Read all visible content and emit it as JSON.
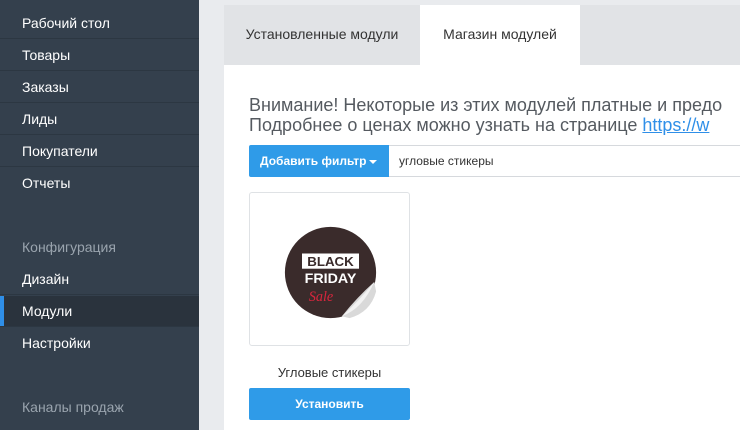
{
  "sidebar": {
    "items": [
      {
        "label": "Рабочий стол"
      },
      {
        "label": "Товары"
      },
      {
        "label": "Заказы"
      },
      {
        "label": "Лиды"
      },
      {
        "label": "Покупатели"
      },
      {
        "label": "Отчеты"
      }
    ],
    "config_section": "Конфигурация",
    "config_items": [
      {
        "label": "Дизайн"
      },
      {
        "label": "Модули",
        "active": true
      },
      {
        "label": "Настройки"
      }
    ],
    "sales_section": "Каналы продаж",
    "active_color": "#2f8fe8",
    "background": "#34404d"
  },
  "tabs": [
    {
      "label": "Установленные модули",
      "active": false
    },
    {
      "label": "Магазин модулей",
      "active": true
    }
  ],
  "notice": {
    "line1": "Внимание! Некоторые из этих модулей платные и предо",
    "line2_prefix": "Подробнее о ценах можно узнать на странице ",
    "line2_link": "https://w"
  },
  "filter": {
    "button_label": "Добавить фильтр",
    "input_value": "угловые стикеры"
  },
  "modules": [
    {
      "title": "Угловые стикеры",
      "install_label": "Установить",
      "image": {
        "icon": "black-friday-sticker-icon",
        "line1": "BLACK",
        "line2": "FRIDAY",
        "line3": "Sale"
      }
    }
  ],
  "colors": {
    "accent": "#2f9be8",
    "link": "#2f8fe8"
  }
}
